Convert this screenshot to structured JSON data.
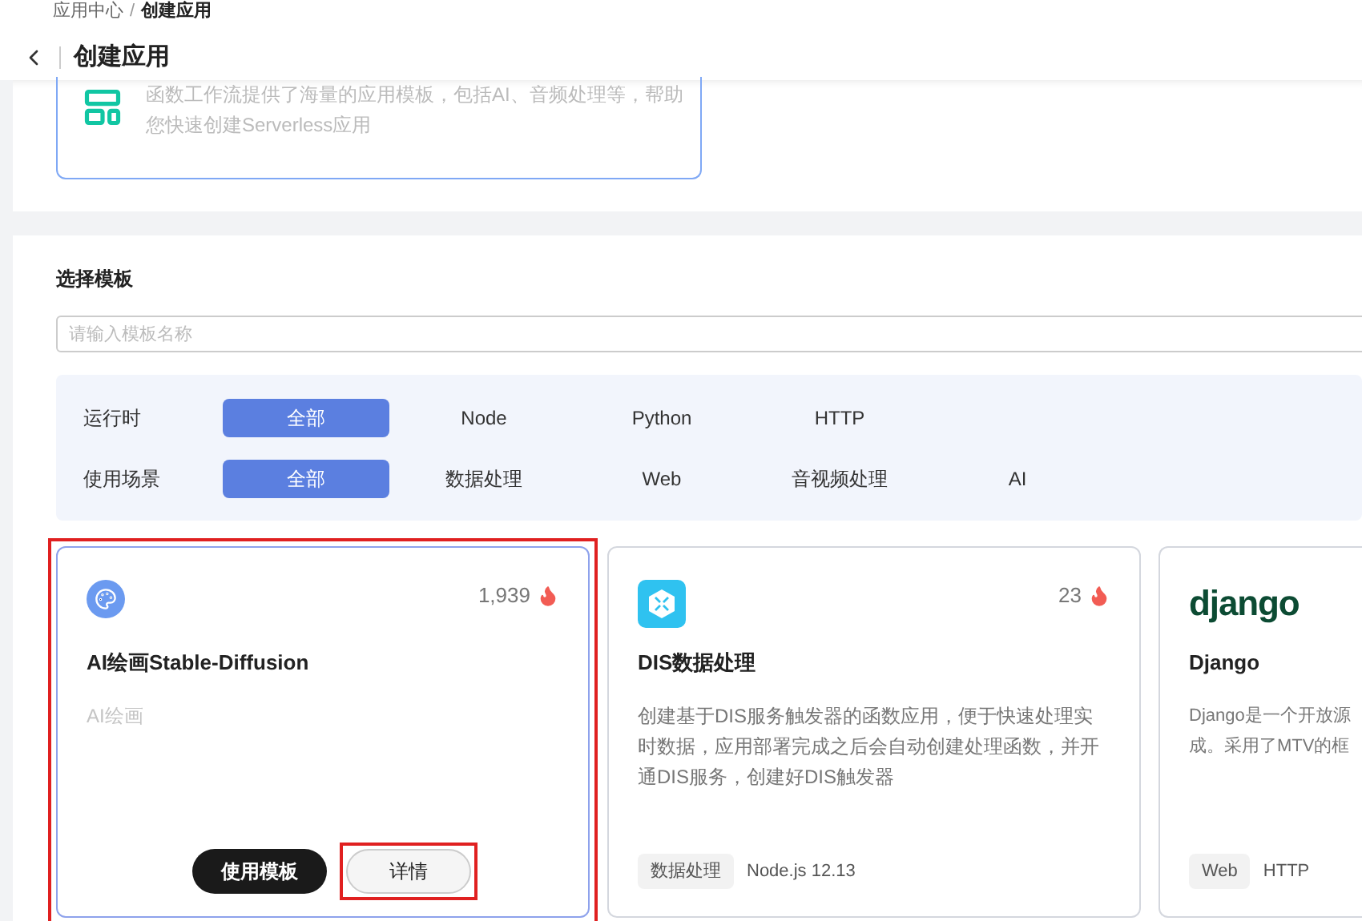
{
  "breadcrumb": [
    {
      "label": "应用中心",
      "current": false
    },
    {
      "label": "创建应用",
      "current": true
    }
  ],
  "breadcrumb_separator": "/",
  "page_title": "创建应用",
  "intro_card": {
    "description": "函数工作流提供了海量的应用模板，包括AI、音频处理等，帮助您快速创建Serverless应用"
  },
  "section_title": "选择模板",
  "search": {
    "placeholder": "请输入模板名称"
  },
  "filters": [
    {
      "label": "运行时",
      "options": [
        {
          "label": "全部",
          "selected": true
        },
        {
          "label": "Node",
          "selected": false
        },
        {
          "label": "Python",
          "selected": false
        },
        {
          "label": "HTTP",
          "selected": false
        }
      ]
    },
    {
      "label": "使用场景",
      "options": [
        {
          "label": "全部",
          "selected": true
        },
        {
          "label": "数据处理",
          "selected": false
        },
        {
          "label": "Web",
          "selected": false
        },
        {
          "label": "音视频处理",
          "selected": false
        },
        {
          "label": "AI",
          "selected": false
        }
      ]
    }
  ],
  "templates": [
    {
      "kind": "palette",
      "title": "AI绘画Stable-Diffusion",
      "count": "1,939",
      "description": [
        "AI绘画"
      ],
      "muted_description": true,
      "hovered": true,
      "highlighted": true,
      "actions": [
        {
          "label": "使用模板",
          "primary": true,
          "highlighted": false
        },
        {
          "label": "详情",
          "primary": false,
          "highlighted": true
        }
      ]
    },
    {
      "kind": "dis",
      "title": "DIS数据处理",
      "count": "23",
      "description": [
        "创建基于DIS服务触发器的函数应用，便于快速处理实时数据，应用部署完成之后会自动创建处理函数，并开通DIS服务，创建好DIS触发器"
      ],
      "muted_description": false,
      "tags": [
        "数据处理",
        "Node.js 12.13"
      ],
      "hovered": false,
      "highlighted": false
    },
    {
      "kind": "django",
      "logo_text": "django",
      "title": "Django",
      "description": [
        "Django是一个开放源",
        "成。采用了MTV的框"
      ],
      "muted_description": false,
      "tags": [
        "Web",
        "HTTP"
      ],
      "hovered": false,
      "highlighted": false
    }
  ]
}
